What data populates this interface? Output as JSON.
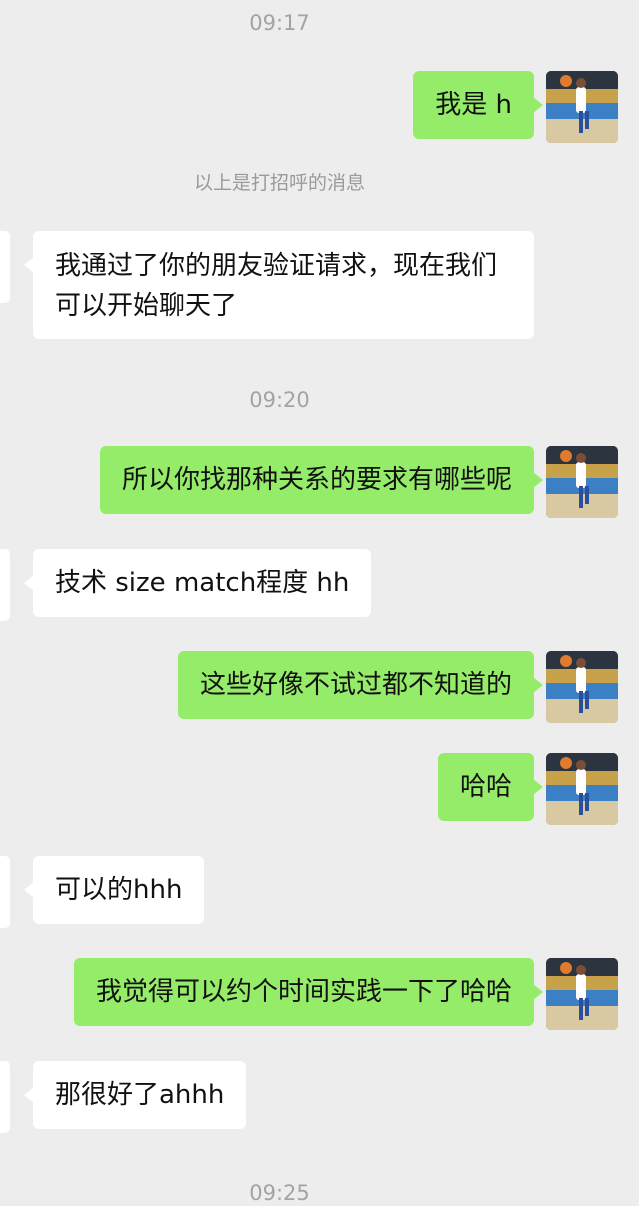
{
  "conversation": {
    "timestamps": [
      "09:17",
      "09:20",
      "09:25"
    ],
    "system_notice": "以上是打招呼的消息",
    "messages": [
      {
        "sender": "me",
        "text": "我是 h"
      },
      {
        "sender": "contact",
        "text": "我通过了你的朋友验证请求，现在我们可以开始聊天了"
      },
      {
        "sender": "me",
        "text": "所以你找那种关系的要求有哪些呢"
      },
      {
        "sender": "contact",
        "text": "技术 size match程度 hh"
      },
      {
        "sender": "me",
        "text": "这些好像不试过都不知道的"
      },
      {
        "sender": "me",
        "text": "哈哈"
      },
      {
        "sender": "contact",
        "text": "可以的hhh"
      },
      {
        "sender": "me",
        "text": "我觉得可以约个时间实践一下了哈哈"
      },
      {
        "sender": "contact",
        "text": "那很好了ahhh"
      }
    ]
  },
  "colors": {
    "background": "#ededed",
    "my_bubble": "#95ec69",
    "their_bubble": "#ffffff",
    "timestamp_text": "#a3a3a3"
  },
  "icons": {
    "my_avatar": "basketball-player-photo",
    "contact_avatar": "contact-avatar-cropped"
  }
}
